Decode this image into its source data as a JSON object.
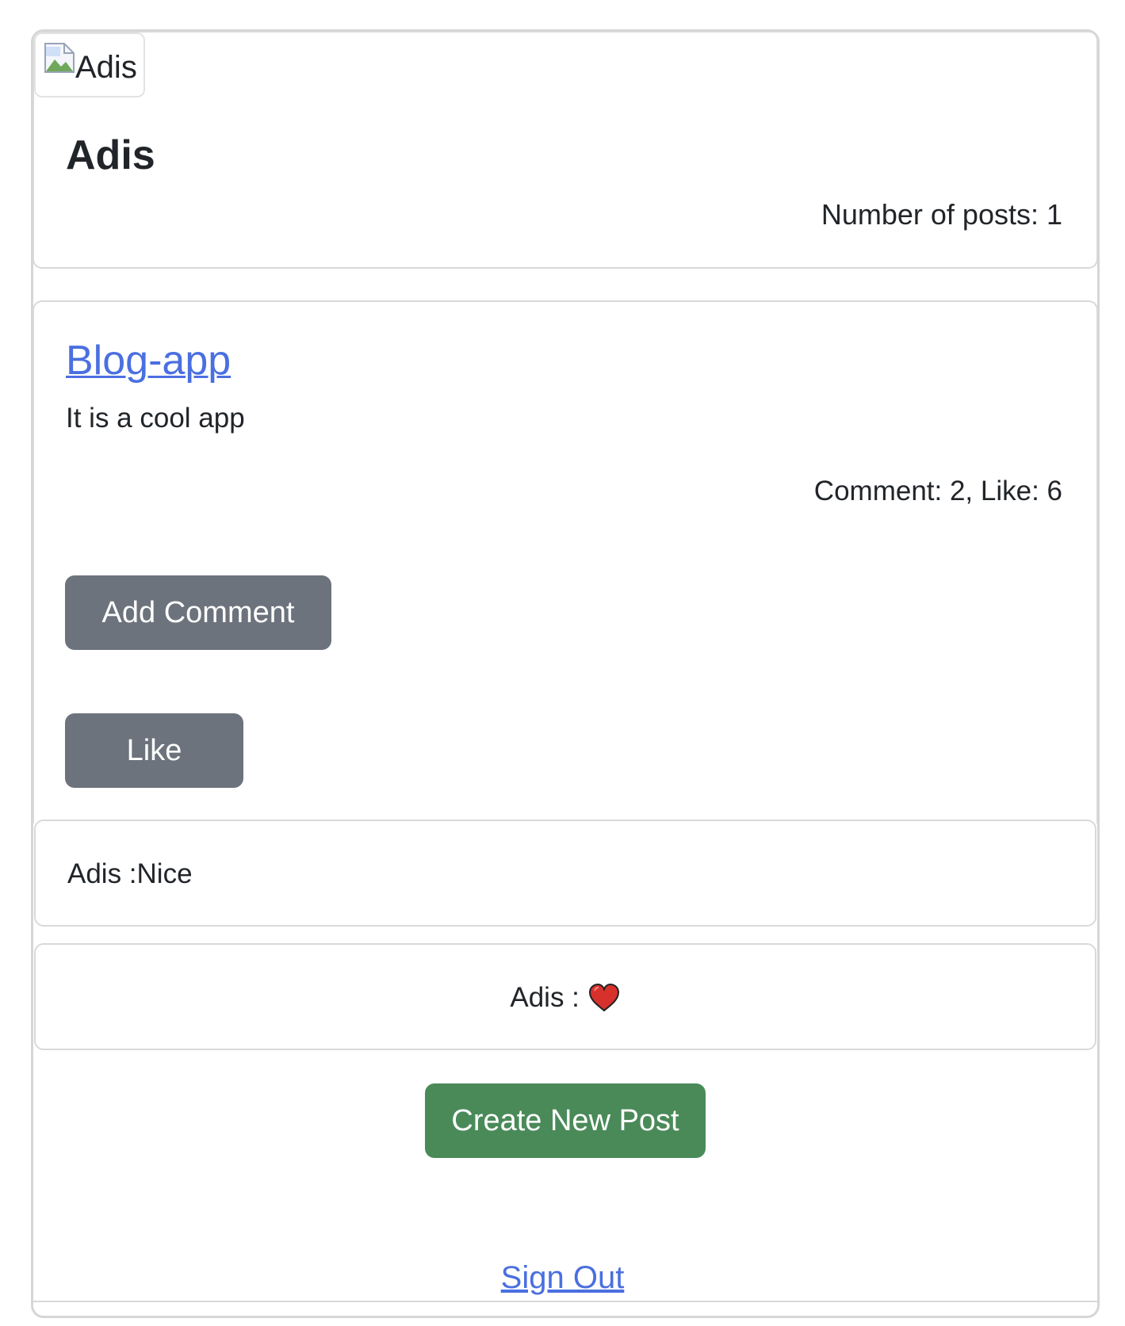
{
  "user": {
    "avatar_alt": "Adis",
    "name": "Adis",
    "posts_count_text": "Number of posts: 1"
  },
  "post": {
    "title": "Blog-app",
    "text": "It is a cool app",
    "stats_text": "Comment: 2, Like: 6",
    "add_comment_label": "Add Comment",
    "like_label": "Like"
  },
  "comments": [
    {
      "text": "Adis :Nice"
    },
    {
      "text": "Adis :",
      "emoji_icon": "heart-icon"
    }
  ],
  "actions": {
    "create_post_label": "Create New Post",
    "sign_out_label": "Sign Out"
  },
  "colors": {
    "link": "#4a6fe0",
    "secondary_button": "#6c737c",
    "success_button": "#4a8a59"
  }
}
